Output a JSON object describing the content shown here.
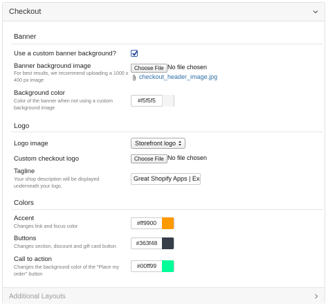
{
  "header": {
    "title": "Checkout",
    "chevron_icon": "chevron-down-icon"
  },
  "banner": {
    "group_title": "Banner",
    "custom_bg_label": "Use a custom banner background?",
    "custom_bg_checked": true,
    "bg_image_label": "Banner background image",
    "bg_image_help": "For best results, we recommend uploading a 1000 x 400 px image",
    "choose_file": "Choose File",
    "no_file": "No file chosen",
    "attached_file": "checkout_header_image.jpg",
    "bg_color_label": "Background color",
    "bg_color_help": "Color of the banner when not using a custom background image",
    "bg_color_value": "#f5f5f5",
    "bg_color_swatch": "#f5f5f5"
  },
  "logo": {
    "group_title": "Logo",
    "logo_image_label": "Logo image",
    "logo_image_selected": "Storefront logo",
    "custom_logo_label": "Custom checkout logo",
    "choose_file": "Choose File",
    "no_file": "No file chosen",
    "tagline_label": "Tagline",
    "tagline_help": "Your shop description will be displayed underneath your logo.",
    "tagline_value": "Great Shopify Apps | Exc"
  },
  "colors": {
    "group_title": "Colors",
    "accent_label": "Accent",
    "accent_help": "Changes link and focus color",
    "accent_value": "#ff9900",
    "accent_swatch": "#ff9900",
    "buttons_label": "Buttons",
    "buttons_help": "Changes section, discount and gift card button",
    "buttons_value": "#363f48",
    "buttons_swatch": "#363f48",
    "cta_label": "Call to action",
    "cta_help": "Changes the background color of the \"Place my order\" button",
    "cta_value": "#00ff99",
    "cta_swatch": "#00ff99"
  },
  "footer": {
    "title": "Additional Layouts",
    "chevron_icon": "chevron-right-icon"
  }
}
